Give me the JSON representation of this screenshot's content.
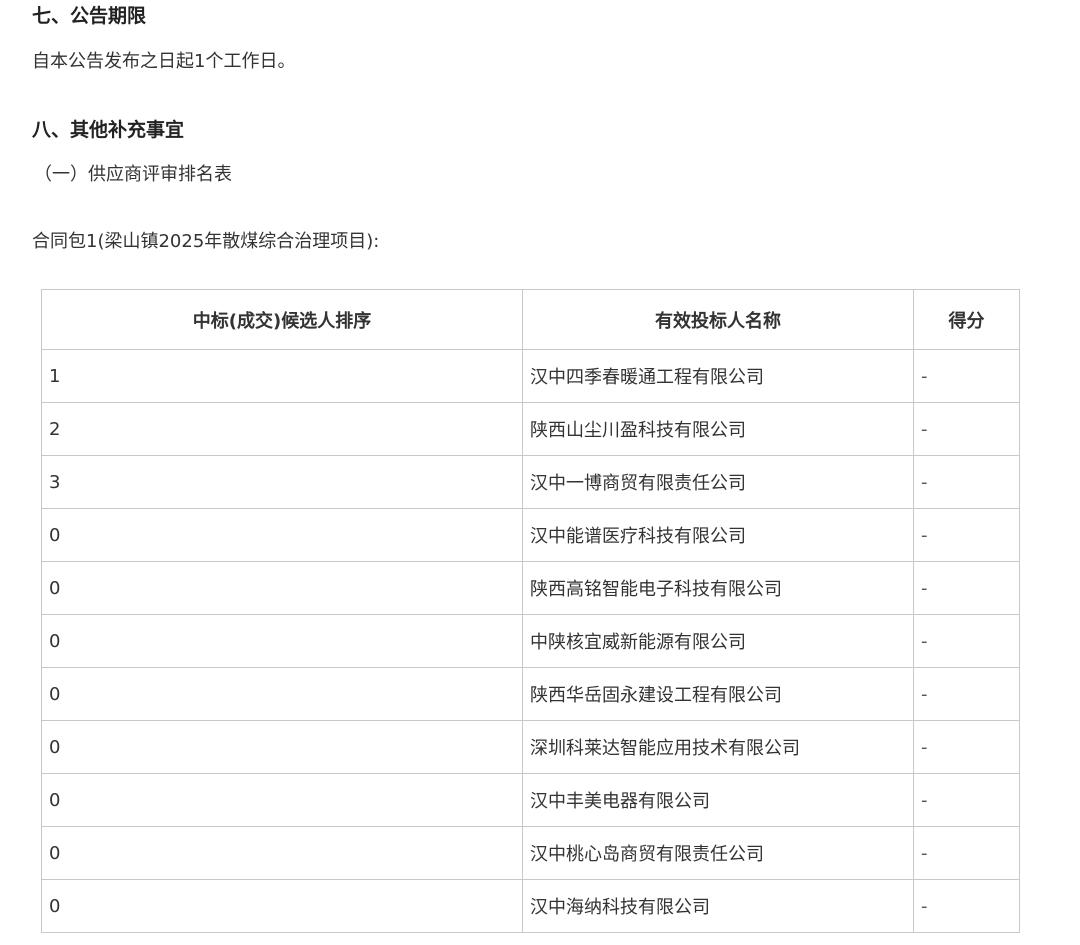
{
  "section7": {
    "title": "七、公告期限",
    "text": "自本公告发布之日起1个工作日。"
  },
  "section8": {
    "title": "八、其他补充事宜",
    "subtitle": "（一）供应商评审排名表",
    "package_label": "合同包1(梁山镇2025年散煤综合治理项目):"
  },
  "table": {
    "headers": [
      "中标(成交)候选人排序",
      "有效投标人名称",
      "得分"
    ],
    "rows": [
      {
        "rank": "1",
        "name": "汉中四季春暖通工程有限公司",
        "score": "-"
      },
      {
        "rank": "2",
        "name": "陕西山尘川盈科技有限公司",
        "score": "-"
      },
      {
        "rank": "3",
        "name": "汉中一博商贸有限责任公司",
        "score": "-"
      },
      {
        "rank": "0",
        "name": "汉中能谱医疗科技有限公司",
        "score": "-"
      },
      {
        "rank": "0",
        "name": "陕西高铭智能电子科技有限公司",
        "score": "-"
      },
      {
        "rank": "0",
        "name": "中陕核宜威新能源有限公司",
        "score": "-"
      },
      {
        "rank": "0",
        "name": "陕西华岳固永建设工程有限公司",
        "score": "-"
      },
      {
        "rank": "0",
        "name": "深圳科莱达智能应用技术有限公司",
        "score": "-"
      },
      {
        "rank": "0",
        "name": "汉中丰美电器有限公司",
        "score": "-"
      },
      {
        "rank": "0",
        "name": "汉中桃心岛商贸有限责任公司",
        "score": "-"
      },
      {
        "rank": "0",
        "name": "汉中海纳科技有限公司",
        "score": "-"
      }
    ]
  }
}
